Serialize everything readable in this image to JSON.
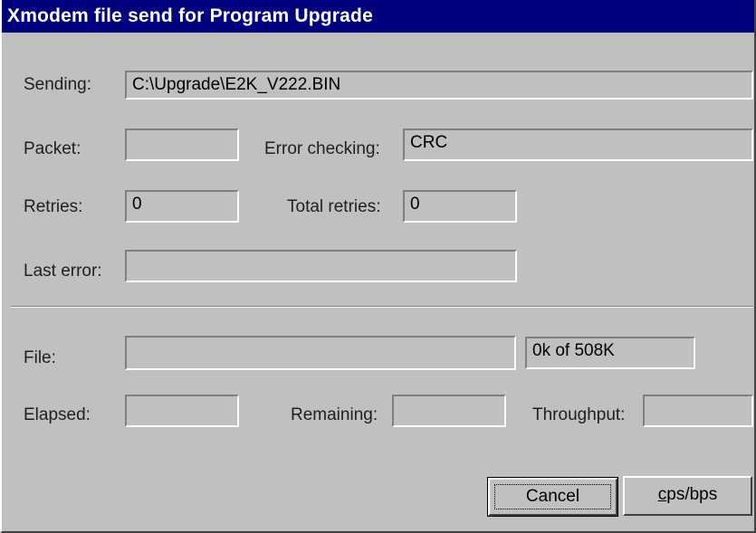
{
  "window": {
    "title": "Xmodem file send for Program Upgrade"
  },
  "labels": {
    "sending": "Sending:",
    "packet": "Packet:",
    "error_checking": "Error checking:",
    "retries": "Retries:",
    "total_retries": "Total retries:",
    "last_error": "Last error:",
    "file": "File:",
    "elapsed": "Elapsed:",
    "remaining": "Remaining:",
    "throughput": "Throughput:"
  },
  "fields": {
    "sending": "C:\\Upgrade\\E2K_V222.BIN",
    "packet": "",
    "error_checking": "CRC",
    "retries": "0",
    "total_retries": "0",
    "last_error": "",
    "file_progress": 0,
    "file_size": "0k of 508K",
    "elapsed": "",
    "remaining": "",
    "throughput": ""
  },
  "buttons": {
    "cancel": "Cancel",
    "cps_bps_accel": "c",
    "cps_bps_rest": "ps/bps"
  }
}
